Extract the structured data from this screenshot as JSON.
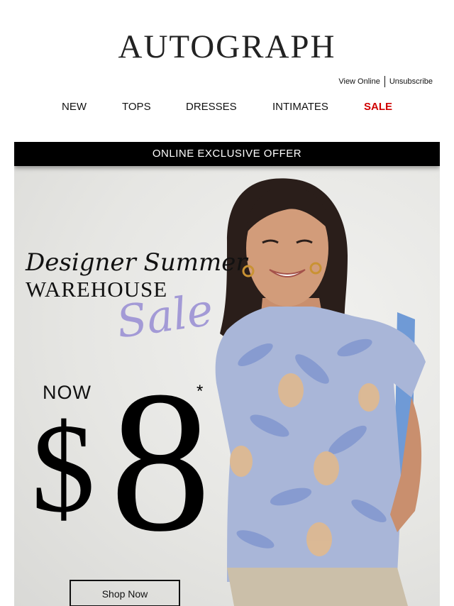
{
  "brand": {
    "logo_text": "AUTOGRAPH"
  },
  "utility": {
    "view_online": "View Online",
    "unsubscribe": "Unsubscribe"
  },
  "nav": {
    "items": [
      {
        "label": "NEW"
      },
      {
        "label": "TOPS"
      },
      {
        "label": "DRESSES"
      },
      {
        "label": "INTIMATES"
      },
      {
        "label": "SALE"
      }
    ]
  },
  "hero": {
    "offer_bar": "ONLINE EXCLUSIVE OFFER",
    "headline_script": "Designer Summer",
    "headline_caps": "WAREHOUSE",
    "headline_sale": "Sale",
    "now_label": "NOW",
    "price_currency": "$",
    "price_amount": "8",
    "price_asterisk": "*",
    "cta_label": "Shop Now"
  },
  "colors": {
    "sale_nav": "#d00000",
    "sale_script": "#a39ad6",
    "offer_bar_bg": "#000000"
  }
}
